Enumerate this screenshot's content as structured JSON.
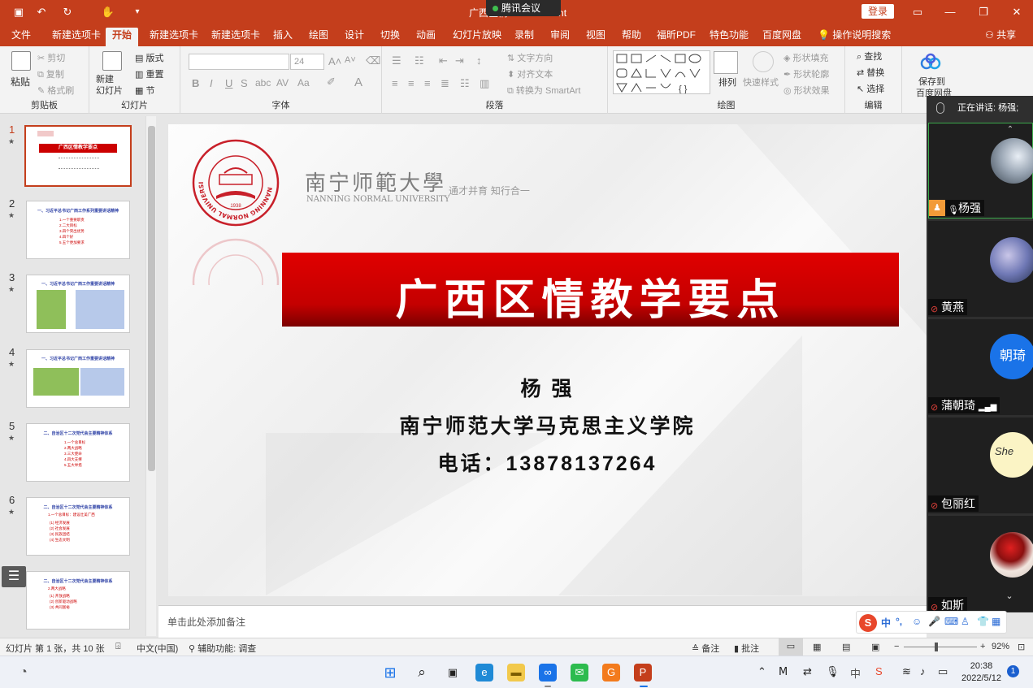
{
  "app": {
    "title": "广西区情 - PowerPoint",
    "meeting_tag": "腾讯会议",
    "login_label": "登录",
    "share_label": "共享"
  },
  "menu_tabs": [
    "文件",
    "新建选项卡",
    "开始",
    "新建选项卡",
    "新建选项卡",
    "插入",
    "绘图",
    "设计",
    "切换",
    "动画",
    "幻灯片放映",
    "录制",
    "审阅",
    "视图",
    "帮助",
    "福昕PDF",
    "特色功能",
    "百度网盘",
    "操作说明搜索"
  ],
  "active_tab_index": 2,
  "ribbon": {
    "clipboard": {
      "label": "剪贴板",
      "paste": "粘贴",
      "cut": "剪切",
      "copy": "复制",
      "format_painter": "格式刷"
    },
    "slides": {
      "label": "幻灯片",
      "new_slide": "新建\n幻灯片",
      "layout": "版式",
      "reset": "重置",
      "section": "节"
    },
    "font": {
      "label": "字体",
      "font_name": "",
      "font_size": "24"
    },
    "paragraph": {
      "label": "段落",
      "text_direction": "文字方向",
      "align_text": "对齐文本",
      "convert_smartart": "转换为 SmartArt"
    },
    "drawing": {
      "label": "绘图",
      "arrange": "排列",
      "quick_styles": "快速样式",
      "shape_fill": "形状填充",
      "shape_outline": "形状轮廓",
      "shape_effects": "形状效果"
    },
    "editing": {
      "label": "编辑",
      "find": "查找",
      "replace": "替换",
      "select": "选择"
    },
    "save_baidu": {
      "line1": "保存到",
      "line2": "百度网盘"
    }
  },
  "thumbnails": [
    {
      "num": "1",
      "title": "广西区情教学要点",
      "lines": []
    },
    {
      "num": "2",
      "title": "一、习近平总书记广西工作系列重要讲话精神",
      "lines": [
        "1.一个重要职责",
        "2.二大目标",
        "3.四个突出优势",
        "4.四个好",
        "5.五个更加要求"
      ]
    },
    {
      "num": "3",
      "title": "一、习近平总书记广西工作重要讲话精神",
      "lines": []
    },
    {
      "num": "4",
      "title": "一、习近平总书记广西工作重要讲话精神",
      "lines": []
    },
    {
      "num": "5",
      "title": "二、自治区十二次党代会主要精神体系",
      "lines": [
        "1.一个总目标",
        "2.两大战略",
        "3.三大使命",
        "4.四大支撑",
        "5.五大举措"
      ]
    },
    {
      "num": "6",
      "title": "二、自治区十二次党代会主要精神体系",
      "lines": [
        "1.一个总目标：建设壮美广西",
        "(1) 经济发展",
        "(2) 社会发展",
        "(3) 民族团结",
        "(4) 生态文明"
      ]
    },
    {
      "num": "7",
      "title": "二、自治区十二次党代会主要精神体系",
      "lines": [
        "2.两大战略",
        "(1) 开放战略",
        "(2) 创新驱动战略",
        "(3) 共同富裕"
      ]
    }
  ],
  "slide": {
    "university_cn": "南宁师範大學",
    "university_en": "NANNING NORMAL UNIVERSITY",
    "motto": "通才并育 知行合一",
    "seal_ring_text": "NANNING NORMAL UNIVERSITY",
    "seal_year": "1938",
    "title": "广西区情教学要点",
    "author": "杨 强",
    "affiliation": "南宁师范大学马克思主义学院",
    "phone": "电话：13878137264"
  },
  "notes_placeholder": "单击此处添加备注",
  "meeting": {
    "speaking": "正在讲话: 杨强;",
    "participants": [
      {
        "name": "杨强",
        "mic": "on",
        "host": true
      },
      {
        "name": "黄燕",
        "mic": "muted"
      },
      {
        "name": "蒲朝琦",
        "mic": "muted",
        "avatar_text": "朝琦"
      },
      {
        "name": "包丽红",
        "mic": "muted"
      },
      {
        "name": "如斯",
        "mic": "muted"
      }
    ]
  },
  "ime": {
    "lang": "中"
  },
  "status": {
    "slide_info": "幻灯片 第 1 张，共 10 张",
    "language": "中文(中国)",
    "accessibility": "辅助功能: 调查",
    "notes": "备注",
    "comments": "批注",
    "zoom": "92%"
  },
  "taskbar": {
    "time": "20:38",
    "date": "2022/5/12",
    "notif": "1",
    "ime": "中"
  },
  "colors": {
    "accent": "#c43e1c",
    "banner": "#d40000",
    "meeting_bg": "#2f2f2f"
  }
}
